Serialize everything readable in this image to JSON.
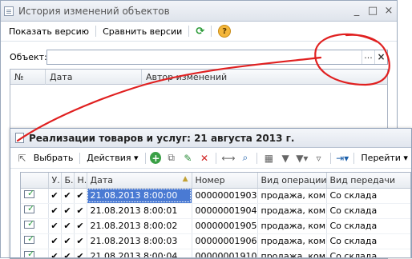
{
  "history_window": {
    "title": "История изменений объектов",
    "controls": {
      "min": "_",
      "max": "□",
      "close": "×"
    },
    "toolbar": {
      "show_version": "Показать версию",
      "compare_versions": "Сравнить версии",
      "help": "?"
    },
    "object_field": {
      "label": "Объект:",
      "value": "",
      "select_btn": "...",
      "clear_btn": "×"
    },
    "table": {
      "columns": [
        "№",
        "Дата",
        "Автор изменений"
      ]
    }
  },
  "sales_window": {
    "title": "Реализации товаров и услуг: 21 августа 2013 г.",
    "toolbar": {
      "select": "Выбрать",
      "actions": "Действия",
      "goto": "Перейти"
    },
    "table": {
      "columns": [
        "",
        "У.",
        "Б.",
        "Н.",
        "Дата",
        "Номер",
        "Вид операции",
        "Вид передачи"
      ],
      "rows": [
        {
          "u": "✔",
          "b": "✔",
          "n": "✔",
          "date": "21.08.2013 8:00:00",
          "number": "00000001903",
          "op": "продажа, ком...",
          "transfer": "Со склада"
        },
        {
          "u": "✔",
          "b": "✔",
          "n": "✔",
          "date": "21.08.2013 8:00:01",
          "number": "00000001904",
          "op": "продажа, ком...",
          "transfer": "Со склада"
        },
        {
          "u": "✔",
          "b": "✔",
          "n": "✔",
          "date": "21.08.2013 8:00:02",
          "number": "00000001905",
          "op": "продажа, ком...",
          "transfer": "Со склада"
        },
        {
          "u": "✔",
          "b": "✔",
          "n": "✔",
          "date": "21.08.2013 8:00:03",
          "number": "00000001906",
          "op": "продажа, ком...",
          "transfer": "Со склада"
        },
        {
          "u": "✔",
          "b": "✔",
          "n": "✔",
          "date": "21.08.2013 8:00:04",
          "number": "00000001910",
          "op": "продажа, ком...",
          "transfer": "Со склада"
        }
      ]
    }
  },
  "colors": {
    "selection": "#4a7ad3",
    "annotation": "#e02020",
    "check": "#28a03c"
  }
}
